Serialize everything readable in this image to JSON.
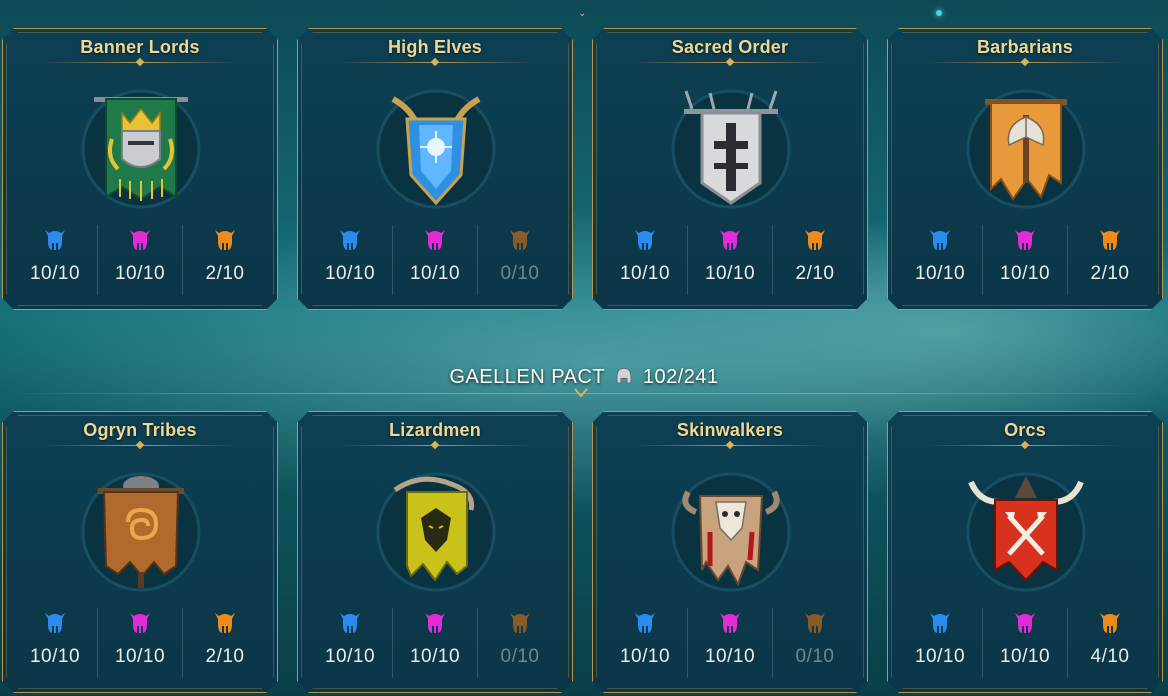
{
  "colors": {
    "blue_helm": "#2b8cf0",
    "magenta_helm": "#e52bd7",
    "orange_helm": "#f08a1a",
    "orange_helm_dim": "#8a5a26",
    "gold": "#d9b35a"
  },
  "alliance_divider": {
    "label": "GAELLEN PACT",
    "count": "102/241",
    "icon": "helmet-icon"
  },
  "factions": [
    {
      "name": "Banner Lords",
      "crest": "banner-lords-crest-icon",
      "blue": "10/10",
      "magenta": "10/10",
      "orange": "2/10",
      "orange_dim": false
    },
    {
      "name": "High Elves",
      "crest": "high-elves-crest-icon",
      "blue": "10/10",
      "magenta": "10/10",
      "orange": "0/10",
      "orange_dim": true
    },
    {
      "name": "Sacred Order",
      "crest": "sacred-order-crest-icon",
      "blue": "10/10",
      "magenta": "10/10",
      "orange": "2/10",
      "orange_dim": false
    },
    {
      "name": "Barbarians",
      "crest": "barbarians-crest-icon",
      "blue": "10/10",
      "magenta": "10/10",
      "orange": "2/10",
      "orange_dim": false
    },
    {
      "name": "Ogryn Tribes",
      "crest": "ogryn-tribes-crest-icon",
      "blue": "10/10",
      "magenta": "10/10",
      "orange": "2/10",
      "orange_dim": false
    },
    {
      "name": "Lizardmen",
      "crest": "lizardmen-crest-icon",
      "blue": "10/10",
      "magenta": "10/10",
      "orange": "0/10",
      "orange_dim": true
    },
    {
      "name": "Skinwalkers",
      "crest": "skinwalkers-crest-icon",
      "blue": "10/10",
      "magenta": "10/10",
      "orange": "0/10",
      "orange_dim": true
    },
    {
      "name": "Orcs",
      "crest": "orcs-crest-icon",
      "blue": "10/10",
      "magenta": "10/10",
      "orange": "4/10",
      "orange_dim": false
    }
  ]
}
